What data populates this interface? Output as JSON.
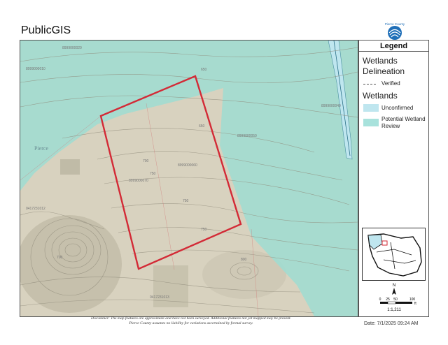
{
  "app": {
    "title": "PublicGIS",
    "logo_text": "Pierce County"
  },
  "map": {
    "place_label": "Pierce",
    "parcel_labels": [
      "8999000020",
      "8999000010",
      "8999000040",
      "8999000050",
      "8999000060",
      "8999000070",
      "0417231012",
      "0417231013"
    ],
    "contour_labels": [
      "650",
      "700",
      "750",
      "750",
      "750",
      "800",
      "650",
      "700"
    ]
  },
  "legend": {
    "title": "Legend",
    "group1": "Wetlands Delineation",
    "verified": "Verified",
    "group2": "Wetlands",
    "unconfirmed": "Unconfirmed",
    "potential": "Potential Wetland Review",
    "colors": {
      "unconfirmed": "#bfe6ef",
      "potential": "#a8e2dc",
      "wetland_fill": "#9fdcd2",
      "parcel_outline": "#d32a36"
    }
  },
  "scale": {
    "north": "N",
    "ticks": [
      "0",
      "25",
      "50",
      "100"
    ],
    "unit": "ft",
    "ratio": "1:1,211"
  },
  "footer": {
    "disclaimer_1": "Disclaimer: The map features are approximate and have not been surveyed. Additional features not yet mapped may be present.",
    "disclaimer_2": "Pierce County assumes no liability for variations ascertained by formal survey.",
    "date": "Date: 7/1/2025  09:24 AM"
  }
}
